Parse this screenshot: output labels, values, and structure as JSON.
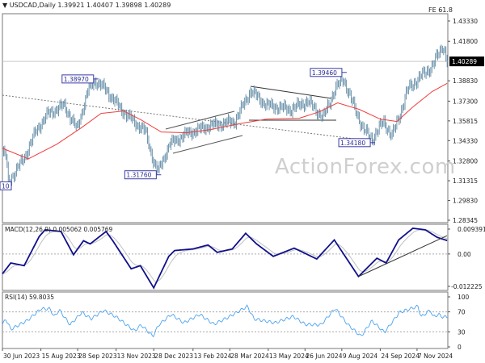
{
  "header": {
    "symbol_label": "USDCAD,Daily",
    "ohlc": "1.39921 1.40407 1.39898 1.40289",
    "fe_label": "FE 61.8",
    "watermark": "ActionForex.com"
  },
  "chart_data": [
    {
      "type": "ohlc",
      "title": "USDCAD,Daily",
      "ylim": [
        1.28345,
        1.4333
      ],
      "y_ticks": [
        "1.43330",
        "1.41800",
        "1.38830",
        "1.37300",
        "1.35815",
        "1.34330",
        "1.32800",
        "1.31315",
        "1.29830",
        "1.28345"
      ],
      "current_price": "1.40289",
      "x_ticks": [
        "30 Jun 2023",
        "15 Aug 2023",
        "28 Sep 2023",
        "13 Nov 2023",
        "28 Dec 2023",
        "13 Feb 2024",
        "28 Mar 2024",
        "13 May 2024",
        "26 Jun 2024",
        "9 Aug 2024",
        "24 Sep 2024",
        "7 Nov 2024"
      ],
      "price_path": [
        [
          "2023-07-04",
          1.3333
        ],
        [
          "2023-07-07",
          1.3119
        ],
        [
          "2023-07-26",
          1.3302
        ],
        [
          "2023-08-10",
          1.3516
        ],
        [
          "2023-08-24",
          1.3638
        ],
        [
          "2023-09-12",
          1.3699
        ],
        [
          "2023-09-27",
          1.3516
        ],
        [
          "2023-10-11",
          1.3821
        ],
        [
          "2023-10-19",
          1.3882
        ],
        [
          "2023-10-31",
          1.3821
        ],
        [
          "2023-11-19",
          1.3668
        ],
        [
          "2023-12-04",
          1.3577
        ],
        [
          "2023-12-18",
          1.3503
        ],
        [
          "2023-12-28",
          1.3272
        ],
        [
          "2024-01-02",
          1.3198
        ],
        [
          "2024-01-16",
          1.3406
        ],
        [
          "2024-02-05",
          1.3485
        ],
        [
          "2024-03-05",
          1.3546
        ],
        [
          "2024-04-03",
          1.3577
        ],
        [
          "2024-04-22",
          1.3808
        ],
        [
          "2024-05-11",
          1.3699
        ],
        [
          "2024-06-09",
          1.3668
        ],
        [
          "2024-06-29",
          1.3729
        ],
        [
          "2024-07-18",
          1.3607
        ],
        [
          "2024-08-01",
          1.3821
        ],
        [
          "2024-08-11",
          1.39
        ],
        [
          "2024-08-21",
          1.3729
        ],
        [
          "2024-09-04",
          1.3516
        ],
        [
          "2024-09-14",
          1.3443
        ],
        [
          "2024-09-28",
          1.3577
        ],
        [
          "2024-10-08",
          1.3467
        ],
        [
          "2024-10-18",
          1.3638
        ],
        [
          "2024-10-27",
          1.3821
        ],
        [
          "2024-11-11",
          1.3912
        ],
        [
          "2024-11-25",
          1.3991
        ],
        [
          "2024-12-05",
          1.4113
        ],
        [
          "2024-12-08",
          1.4156
        ],
        [
          "2024-12-13",
          1.40289
        ]
      ],
      "moving_average": [
        [
          "2023-06-30",
          1.3376
        ],
        [
          "2023-07-31",
          1.3296
        ],
        [
          "2023-09-03",
          1.3406
        ],
        [
          "2023-10-02",
          1.3528
        ],
        [
          "2023-10-26",
          1.3638
        ],
        [
          "2023-11-22",
          1.3656
        ],
        [
          "2023-12-13",
          1.3589
        ],
        [
          "2024-01-06",
          1.3498
        ],
        [
          "2024-02-05",
          1.3492
        ],
        [
          "2024-03-05",
          1.3516
        ],
        [
          "2024-04-07",
          1.3559
        ],
        [
          "2024-05-11",
          1.3595
        ],
        [
          "2024-06-19",
          1.3601
        ],
        [
          "2024-07-13",
          1.365
        ],
        [
          "2024-08-04",
          1.3717
        ],
        [
          "2024-08-30",
          1.3668
        ],
        [
          "2024-09-24",
          1.3595
        ],
        [
          "2024-10-14",
          1.3577
        ],
        [
          "2024-11-01",
          1.3681
        ],
        [
          "2024-11-25",
          1.3802
        ],
        [
          "2024-12-13",
          1.3864
        ]
      ],
      "annotations": [
        {
          "label": "1.38970",
          "date": "2023-10-19",
          "price": 1.3897
        },
        {
          "label": "1.31760",
          "date": "2024-01-02",
          "price": 1.3176
        },
        {
          "label": "1.39460",
          "date": "2024-08-11",
          "price": 1.3946
        },
        {
          "label": "1.34180",
          "date": "2024-09-14",
          "price": 1.3418
        },
        {
          "label": "10",
          "date": "2023-07-07",
          "price": 1.3093
        }
      ],
      "colors": {
        "bars": "#5f89a3",
        "moving_average": "#f03c3c",
        "label_border": "#3a3aa8",
        "trendline": "#555555"
      }
    },
    {
      "type": "line",
      "title": "MACD(12,26,9) 0.005062 0.005769",
      "ylim": [
        -0.012225,
        0.009391
      ],
      "y_ticks": [
        "0.009391",
        "0.00",
        "-0.012225"
      ],
      "macd": [
        [
          "2023-06-30",
          -0.0075
        ],
        [
          "2023-07-10",
          -0.0034
        ],
        [
          "2023-07-26",
          -0.0044
        ],
        [
          "2023-08-13",
          0.0066
        ],
        [
          "2023-08-20",
          0.0091
        ],
        [
          "2023-09-08",
          0.0085
        ],
        [
          "2023-09-23",
          -0.0003
        ],
        [
          "2023-10-05",
          0.005
        ],
        [
          "2023-10-13",
          0.0038
        ],
        [
          "2023-11-01",
          0.0085
        ],
        [
          "2023-11-09",
          0.005
        ],
        [
          "2023-12-01",
          -0.0056
        ],
        [
          "2023-12-12",
          -0.0044
        ],
        [
          "2023-12-28",
          -0.0128
        ],
        [
          "2024-01-15",
          -0.0009
        ],
        [
          "2024-01-22",
          0.0013
        ],
        [
          "2024-02-13",
          0.0019
        ],
        [
          "2024-03-02",
          0.0034
        ],
        [
          "2024-03-13",
          0.0006
        ],
        [
          "2024-03-31",
          0.0019
        ],
        [
          "2024-04-16",
          0.0078
        ],
        [
          "2024-04-29",
          0.0038
        ],
        [
          "2024-05-19",
          -0.0009
        ],
        [
          "2024-06-13",
          0.0022
        ],
        [
          "2024-07-10",
          -0.0019
        ],
        [
          "2024-07-31",
          0.0053
        ],
        [
          "2024-08-29",
          -0.0085
        ],
        [
          "2024-09-20",
          -0.0016
        ],
        [
          "2024-10-01",
          -0.0034
        ],
        [
          "2024-10-16",
          0.0053
        ],
        [
          "2024-11-02",
          0.0097
        ],
        [
          "2024-11-17",
          0.0091
        ],
        [
          "2024-12-01",
          0.0063
        ],
        [
          "2024-12-13",
          0.005062
        ]
      ],
      "colors": {
        "macd": "#10108c",
        "signal": "#c0c0c0"
      }
    },
    {
      "type": "line",
      "title": "RSI(14) 59.8035",
      "ylim": [
        0,
        100
      ],
      "y_ticks": [
        "100",
        "70",
        "30",
        "0"
      ],
      "levels": [
        70,
        30
      ],
      "rsi": [
        [
          "2023-06-30",
          44
        ],
        [
          "2023-07-04",
          56
        ],
        [
          "2023-07-10",
          35
        ],
        [
          "2023-07-30",
          53
        ],
        [
          "2023-08-15",
          76
        ],
        [
          "2023-08-26",
          76
        ],
        [
          "2023-08-31",
          60
        ],
        [
          "2023-09-06",
          74
        ],
        [
          "2023-09-19",
          44
        ],
        [
          "2023-10-03",
          69
        ],
        [
          "2023-10-14",
          56
        ],
        [
          "2023-10-29",
          73
        ],
        [
          "2023-11-13",
          60
        ],
        [
          "2023-12-05",
          32
        ],
        [
          "2023-12-13",
          44
        ],
        [
          "2023-12-27",
          21
        ],
        [
          "2024-01-03",
          44
        ],
        [
          "2024-01-18",
          65
        ],
        [
          "2024-02-02",
          48
        ],
        [
          "2024-02-21",
          65
        ],
        [
          "2024-03-09",
          45
        ],
        [
          "2024-03-27",
          60
        ],
        [
          "2024-04-18",
          81
        ],
        [
          "2024-04-26",
          56
        ],
        [
          "2024-05-21",
          48
        ],
        [
          "2024-06-12",
          61
        ],
        [
          "2024-06-26",
          45
        ],
        [
          "2024-07-15",
          44
        ],
        [
          "2024-08-01",
          77
        ],
        [
          "2024-08-16",
          45
        ],
        [
          "2024-09-01",
          21
        ],
        [
          "2024-09-14",
          52
        ],
        [
          "2024-09-29",
          29
        ],
        [
          "2024-10-17",
          69
        ],
        [
          "2024-11-08",
          81
        ],
        [
          "2024-11-12",
          60
        ],
        [
          "2024-11-23",
          74
        ],
        [
          "2024-11-26",
          60
        ],
        [
          "2024-12-03",
          65
        ],
        [
          "2024-12-07",
          60
        ],
        [
          "2024-12-13",
          59.8035
        ]
      ],
      "colors": {
        "rsi": "#4da3f0"
      }
    }
  ]
}
